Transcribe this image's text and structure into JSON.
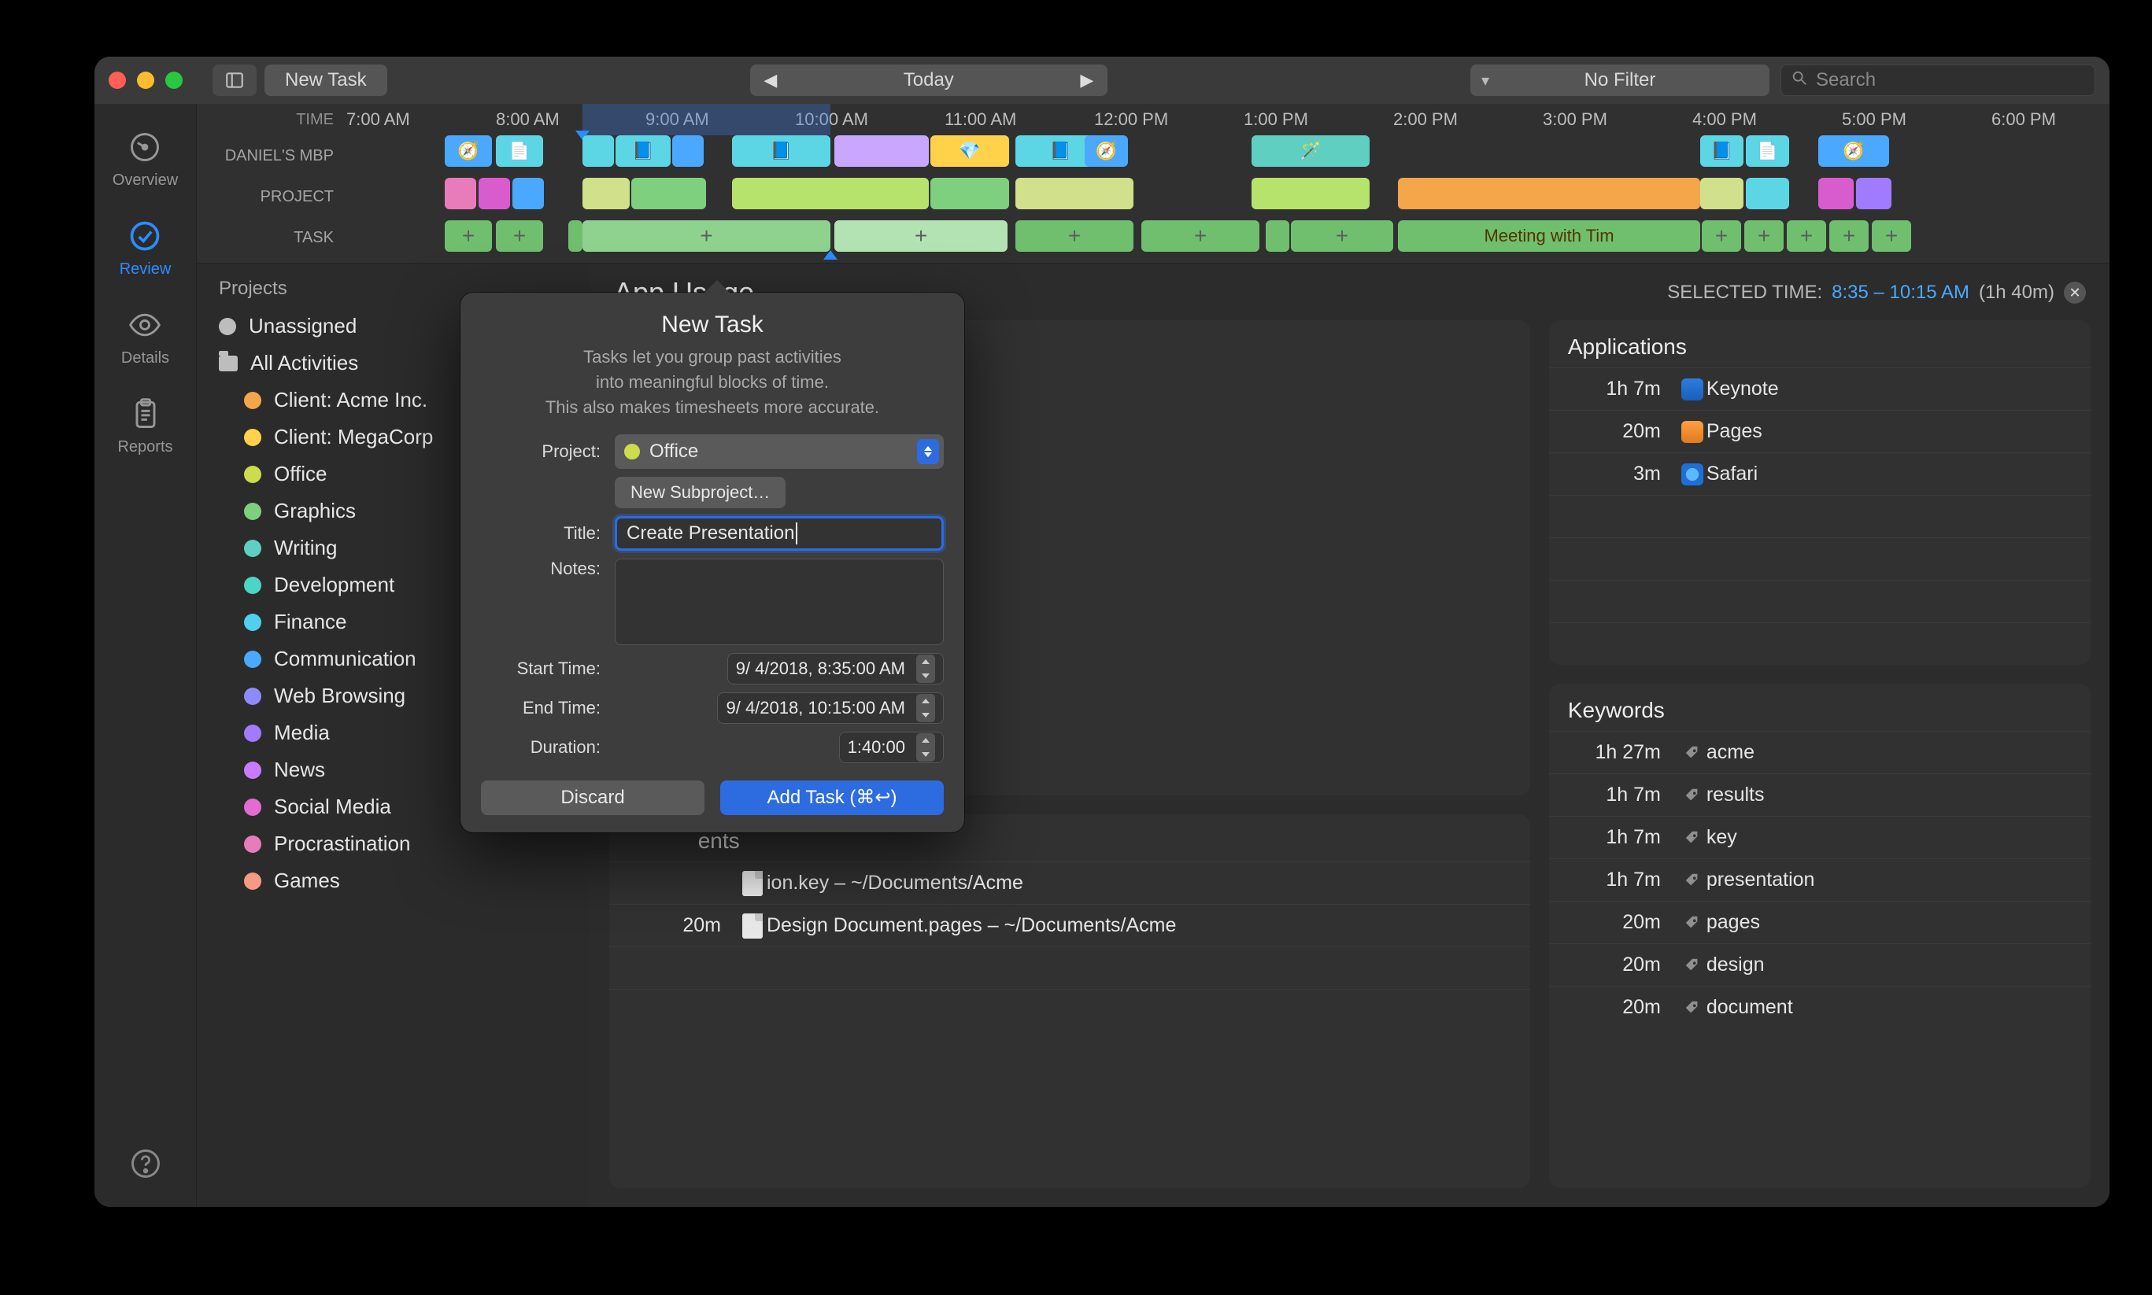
{
  "titlebar": {
    "new_task": "New Task",
    "today": "Today",
    "filter": "No Filter",
    "search_placeholder": "Search"
  },
  "rail": {
    "overview": "Overview",
    "review": "Review",
    "details": "Details",
    "reports": "Reports"
  },
  "timeline": {
    "labels": {
      "time": "TIME",
      "device": "DANIEL'S MBP",
      "project": "PROJECT",
      "task": "TASK"
    },
    "hours": [
      "7:00 AM",
      "8:00 AM",
      "9:00 AM",
      "10:00 AM",
      "11:00 AM",
      "12:00 PM",
      "1:00 PM",
      "2:00 PM",
      "3:00 PM",
      "4:00 PM",
      "5:00 PM",
      "6:00 PM"
    ],
    "task_main": "Meeting with Tim",
    "task_plus": "+"
  },
  "sidebar": {
    "head": "Projects",
    "unassigned": "Unassigned",
    "all": "All Activities",
    "items": [
      {
        "label": "Client: Acme Inc.",
        "color": "#f5a54a"
      },
      {
        "label": "Client: MegaCorp",
        "color": "#ffd24a"
      },
      {
        "label": "Office",
        "color": "#cddc4d"
      },
      {
        "label": "Graphics",
        "color": "#7ed07e"
      },
      {
        "label": "Writing",
        "color": "#5ecfc1"
      },
      {
        "label": "Development",
        "color": "#49d6c7"
      },
      {
        "label": "Finance",
        "color": "#4ed0ee"
      },
      {
        "label": "Communication",
        "color": "#4aa8ff"
      },
      {
        "label": "Web Browsing",
        "color": "#8b8bff"
      },
      {
        "label": "Media",
        "color": "#a07bff"
      },
      {
        "label": "News",
        "color": "#c97bff"
      },
      {
        "label": "Social Media",
        "color": "#e36bd2"
      },
      {
        "label": "Procrastination",
        "color": "#e87bb9"
      },
      {
        "label": "Games",
        "color": "#f59b84"
      }
    ]
  },
  "header": {
    "title_dropdown": "App Usage",
    "selected_label": "SELECTED TIME:",
    "range": "8:35 – 10:15 AM",
    "dur": "(1h 40m)"
  },
  "applications": {
    "title": "Applications",
    "rows": [
      {
        "dur": "1h 7m",
        "icon": "keynote",
        "label": "Keynote"
      },
      {
        "dur": "20m",
        "icon": "pages",
        "label": "Pages"
      },
      {
        "dur": "3m",
        "icon": "safari",
        "label": "Safari"
      }
    ]
  },
  "documents": {
    "title_suffix": "ents",
    "rows": [
      {
        "dur": "",
        "label": "ion.key – ~/Documents/Acme"
      },
      {
        "dur": "20m",
        "label": "Design Document.pages – ~/Documents/Acme"
      }
    ]
  },
  "keywords": {
    "title": "Keywords",
    "rows": [
      {
        "dur": "1h 27m",
        "label": "acme"
      },
      {
        "dur": "1h 7m",
        "label": "results"
      },
      {
        "dur": "1h 7m",
        "label": "key"
      },
      {
        "dur": "1h 7m",
        "label": "presentation"
      },
      {
        "dur": "20m",
        "label": "pages"
      },
      {
        "dur": "20m",
        "label": "design"
      },
      {
        "dur": "20m",
        "label": "document"
      }
    ]
  },
  "popover": {
    "title": "New Task",
    "sub1": "Tasks let you group past activities",
    "sub2": "into meaningful blocks of time.",
    "sub3": "This also makes timesheets more accurate.",
    "project_lbl": "Project:",
    "project_val": "Office",
    "new_subproject": "New Subproject…",
    "title_lbl": "Title:",
    "title_val": "Create Presentation",
    "notes_lbl": "Notes:",
    "start_lbl": "Start Time:",
    "start_val": "9/  4/2018,   8:35:00 AM",
    "end_lbl": "End Time:",
    "end_val": "9/  4/2018, 10:15:00 AM",
    "dur_lbl": "Duration:",
    "dur_val": "1:40:00",
    "discard": "Discard",
    "add": "Add Task (⌘↩)"
  }
}
